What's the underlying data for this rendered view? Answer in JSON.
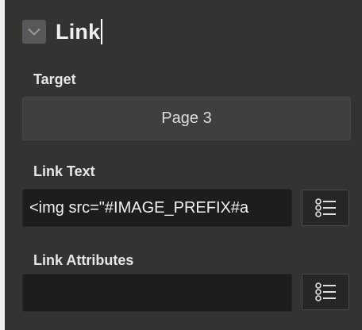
{
  "section": {
    "title": "Link",
    "collapse_icon": "chevron-down-icon"
  },
  "target": {
    "label": "Target",
    "value": "Page 3"
  },
  "link_text": {
    "label": "Link Text",
    "value": "<img src=\"#IMAGE_PREFIX#a",
    "button_icon": "list-icon"
  },
  "link_attributes": {
    "label": "Link Attributes",
    "value": "",
    "button_icon": "list-icon"
  },
  "colors": {
    "panel_background": "#333331",
    "input_background": "#1d1d1d",
    "button_background": "#3f3f3f",
    "text": "#e6e6e6"
  }
}
